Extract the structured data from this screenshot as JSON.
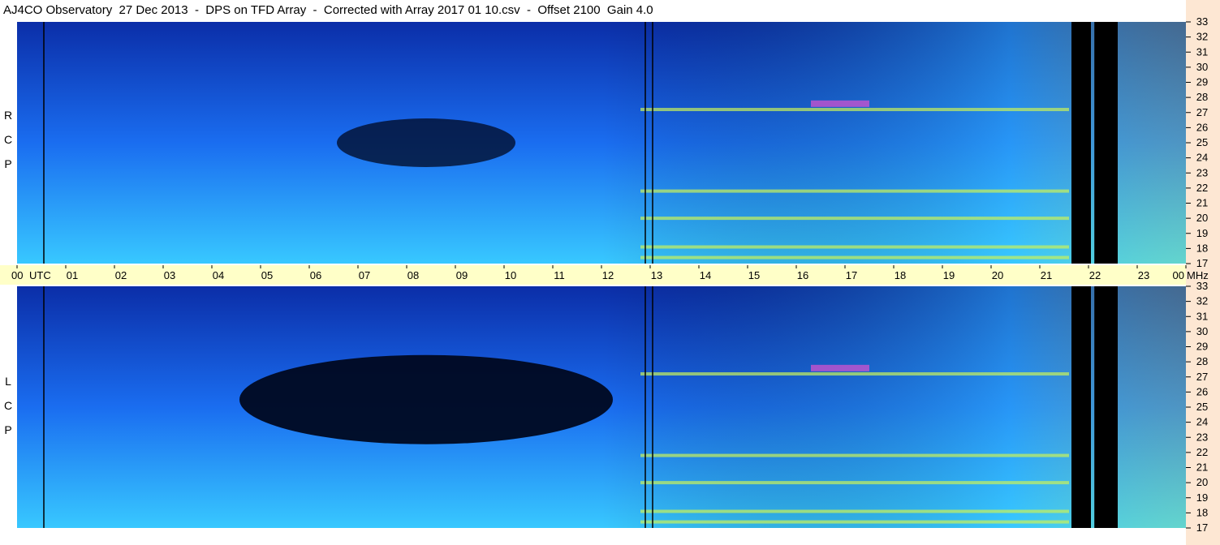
{
  "title": "AJ4CO Observatory  27 Dec 2013  -  DPS on TFD Array  -  Corrected with Array 2017 01 10.csv  -  Offset 2100  Gain 4.0",
  "chart_data": {
    "type": "heatmap",
    "title": "AJ4CO Observatory  27 Dec 2013  -  DPS on TFD Array  -  Corrected with Array 2017 01 10.csv  -  Offset 2100  Gain 4.0",
    "panels": [
      {
        "name": "RCP",
        "letters": [
          "R",
          "C",
          "P"
        ]
      },
      {
        "name": "LCP",
        "letters": [
          "L",
          "C",
          "P"
        ]
      }
    ],
    "x_axis": {
      "label": "UTC",
      "ticks": [
        "00",
        "01",
        "02",
        "03",
        "04",
        "05",
        "06",
        "07",
        "08",
        "09",
        "10",
        "11",
        "12",
        "13",
        "14",
        "15",
        "16",
        "17",
        "18",
        "19",
        "20",
        "21",
        "22",
        "23",
        "00"
      ],
      "range": [
        0,
        24
      ]
    },
    "y_axis": {
      "label": "MHz",
      "ticks": [
        "33",
        "32",
        "31",
        "30",
        "29",
        "28",
        "27",
        "26",
        "25",
        "24",
        "23",
        "22",
        "21",
        "20",
        "19",
        "18",
        "17"
      ],
      "range": [
        17,
        33
      ]
    },
    "dropouts_utc": [
      [
        21.65,
        22.05
      ],
      [
        22.12,
        22.6
      ]
    ],
    "markers_utc": [
      0.55,
      12.9,
      13.05
    ],
    "utc_tick_label": "UTC",
    "mhz_tick_label": "MHz",
    "colors": {
      "background": "#ffffff",
      "time_band": "#ffffc8",
      "right_gutter": "#fde7d3",
      "low": "#0b2ea8",
      "mid": "#1a6df0",
      "high": "#38c8ff",
      "hot": "#c9f25a",
      "peak": "#ff4fd0"
    }
  }
}
